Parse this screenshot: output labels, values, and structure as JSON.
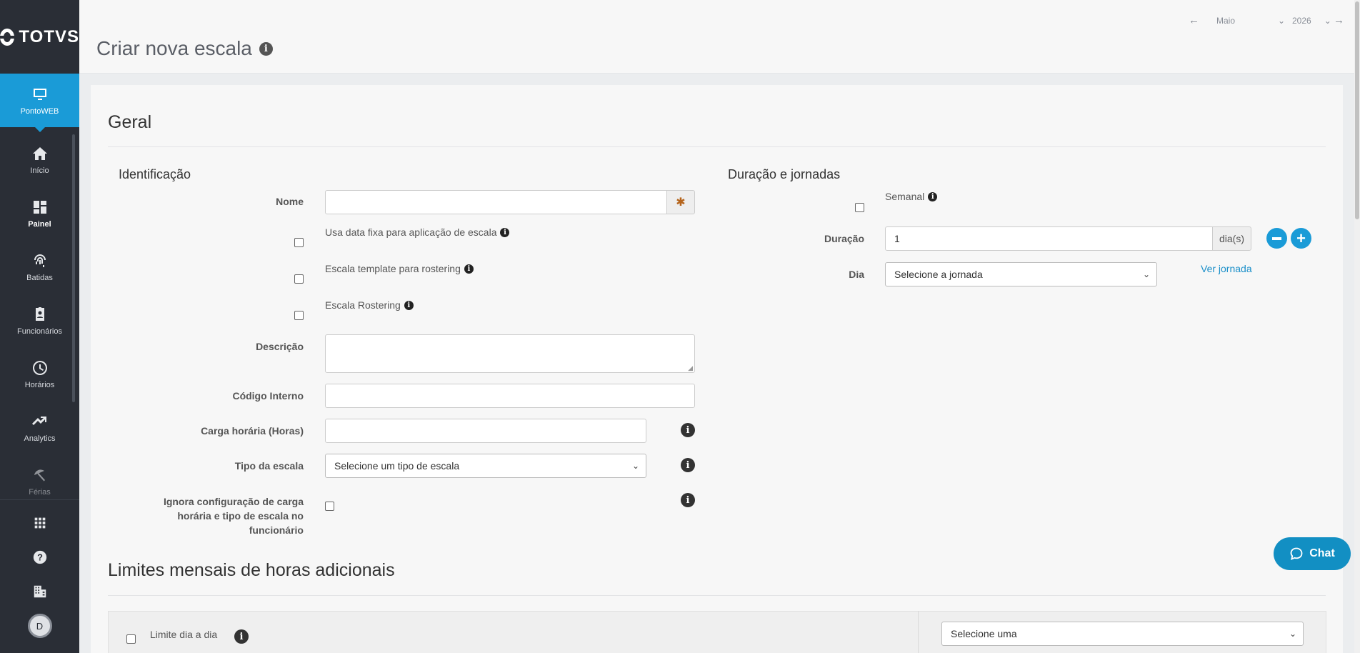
{
  "brand": {
    "name": "TOTVS"
  },
  "app_switcher": {
    "label": "PontoWEB"
  },
  "nav": {
    "items": [
      {
        "label": "Início"
      },
      {
        "label": "Painel"
      },
      {
        "label": "Batidas"
      },
      {
        "label": "Funcionários"
      },
      {
        "label": "Horários"
      },
      {
        "label": "Analytics"
      },
      {
        "label": "Férias"
      }
    ]
  },
  "user": {
    "initial": "D"
  },
  "header": {
    "title": "Criar nova escala",
    "month": "Maio",
    "year": "2026"
  },
  "general": {
    "title": "Geral",
    "identification": {
      "title": "Identificação",
      "nome_label": "Nome",
      "nome_value": "",
      "fixed_date_label": "Usa data fixa para aplicação de escala",
      "template_label": "Escala template para rostering",
      "rostering_label": "Escala Rostering",
      "descricao_label": "Descrição",
      "codigo_label": "Código Interno",
      "carga_label": "Carga horária (Horas)",
      "tipo_label": "Tipo da escala",
      "tipo_value": "Selecione um tipo de escala",
      "ignora_label_1": "Ignora configuração de carga",
      "ignora_label_2": "horária e tipo de escala no",
      "ignora_label_3": "funcionário"
    },
    "duration": {
      "title": "Duração e jornadas",
      "semanal_label": "Semanal",
      "duracao_label": "Duração",
      "duracao_value": "1",
      "duracao_unit": "dia(s)",
      "dia_label": "Dia",
      "dia_value": "Selecione a jornada",
      "ver_jornada": "Ver jornada"
    }
  },
  "limits": {
    "title": "Limites mensais de horas adicionais",
    "limite_label": "Limite dia a dia",
    "select_value": "Selecione uma"
  },
  "chat": {
    "label": "Chat"
  },
  "colors": {
    "accent": "#1a9bd7",
    "sidebar": "#2a2e36",
    "chat": "#128fc3"
  }
}
